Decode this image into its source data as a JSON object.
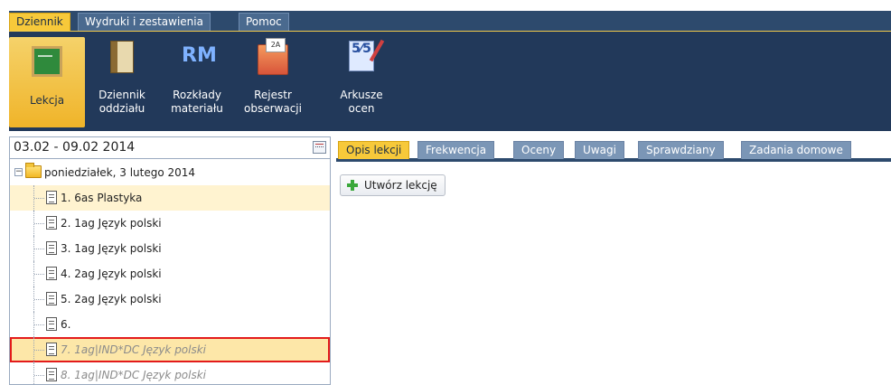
{
  "menu": {
    "tabs": [
      {
        "label": "Dziennik",
        "active": true
      },
      {
        "label": "Wydruki i zestawienia",
        "active": false
      },
      {
        "label": "Pomoc",
        "active": false
      }
    ]
  },
  "ribbon": {
    "buttons": [
      {
        "label": "Lekcja",
        "icon": "chalkboard-icon",
        "active": true
      },
      {
        "label": "Dziennik oddziału",
        "icon": "book-icon",
        "active": false
      },
      {
        "label": "Rozkłady materiału",
        "icon": "rm-icon",
        "icon_text": "RM",
        "active": false
      },
      {
        "label": "Rejestr obserwacji",
        "icon": "folder-register-icon",
        "active": false
      },
      {
        "label": "Arkusze ocen",
        "icon": "grade-sheet-icon",
        "icon_text": "5⁄5",
        "active": false
      }
    ]
  },
  "date_range": {
    "value": "03.02 - 09.02 2014"
  },
  "tree": {
    "root": {
      "label": "poniedziałek, 3 lutego 2014",
      "expanded": true
    },
    "items": [
      {
        "label": "1. 6as Plastyka",
        "selected": true,
        "highlighted": false,
        "muted": false
      },
      {
        "label": "2. 1ag Język polski",
        "selected": false,
        "highlighted": false,
        "muted": false
      },
      {
        "label": "3. 1ag Język polski",
        "selected": false,
        "highlighted": false,
        "muted": false
      },
      {
        "label": "4. 2ag Język polski",
        "selected": false,
        "highlighted": false,
        "muted": false
      },
      {
        "label": "5. 2ag Język polski",
        "selected": false,
        "highlighted": false,
        "muted": false
      },
      {
        "label": "6.",
        "selected": false,
        "highlighted": false,
        "muted": false
      },
      {
        "label": "7. 1ag|IND*DC Język polski",
        "selected": false,
        "highlighted": true,
        "muted": true
      },
      {
        "label": "8. 1ag|IND*DC Język polski",
        "selected": false,
        "highlighted": false,
        "muted": true
      }
    ]
  },
  "content_tabs": [
    {
      "label": "Opis lekcji",
      "active": true
    },
    {
      "label": "Frekwencja",
      "active": false
    },
    {
      "label": "Oceny",
      "active": false
    },
    {
      "label": "Uwagi",
      "active": false
    },
    {
      "label": "Sprawdziany",
      "active": false
    },
    {
      "label": "Zadania domowe",
      "active": false
    }
  ],
  "actions": {
    "create_lesson_label": "Utwórz lekcję"
  },
  "colors": {
    "accent": "#f7c93a",
    "ribbon_bg": "#22395a",
    "highlight_border": "#e31b1b"
  }
}
